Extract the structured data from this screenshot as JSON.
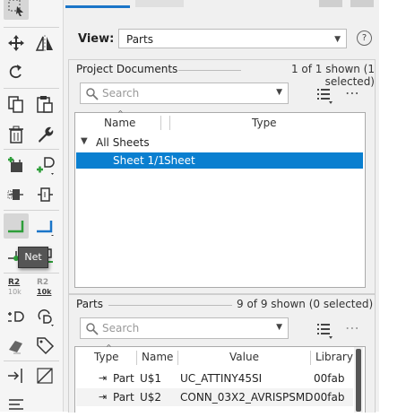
{
  "toolbar": {
    "tooltip": "Net",
    "resistor_left_label": "R2",
    "resistor_left_value": "10k",
    "resistor_right_label": "R2",
    "resistor_right_value": "10k"
  },
  "panel": {
    "view_label": "View:",
    "view_value": "Parts",
    "help": "?",
    "project_documents": {
      "title": "Project Documents",
      "count": "1 of 1 shown (1 selected)",
      "search_placeholder": "Search",
      "col_name": "Name",
      "col_type": "Type",
      "root": "All Sheets",
      "selected_row_name": "Sheet 1/1",
      "selected_row_type": "Sheet"
    },
    "parts": {
      "title": "Parts",
      "count": "9 of 9 shown (0 selected)",
      "search_placeholder": "Search",
      "columns": [
        "Type",
        "Name",
        "Value",
        "Library"
      ],
      "rows": [
        {
          "type": "Part",
          "name": "U$1",
          "value": "UC_ATTINY45SI",
          "library": "00fab"
        },
        {
          "type": "Part",
          "name": "U$2",
          "value": "CONN_03X2_AVRISPSMD",
          "library": "00fab"
        }
      ]
    }
  },
  "colors": {
    "accent": "#1a75c8",
    "selection": "#0a7fd0",
    "toolbar_green": "#2e9e3a",
    "toolbar_blue": "#1a75c8"
  }
}
